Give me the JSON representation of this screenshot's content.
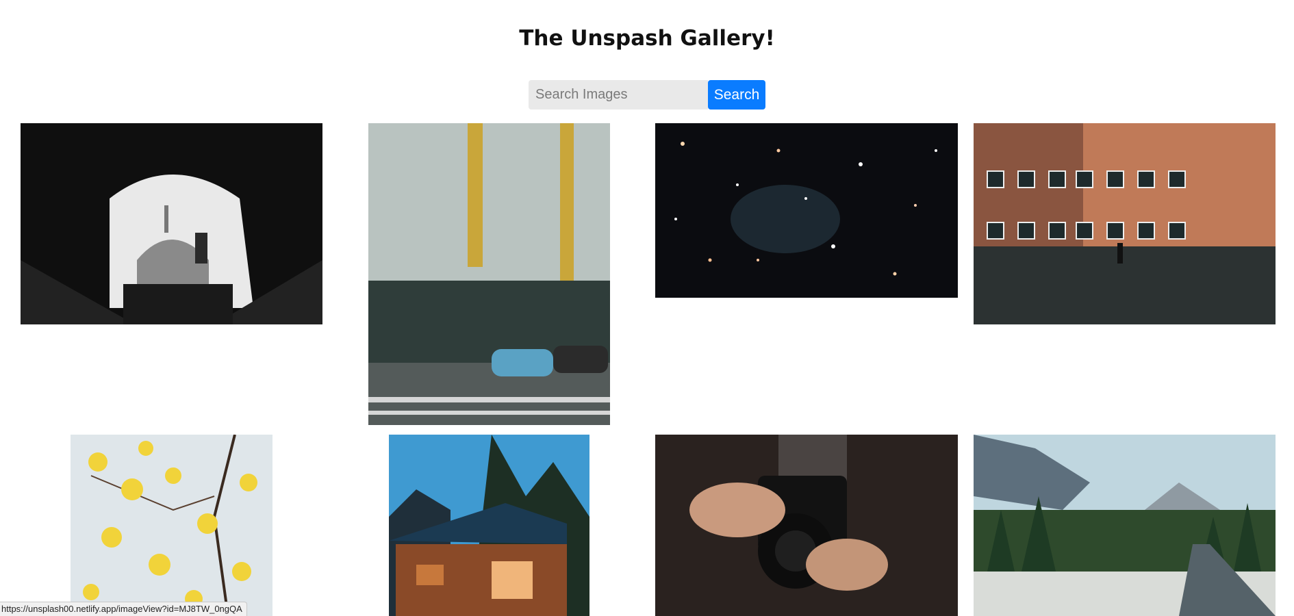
{
  "page": {
    "title": "The Unspash Gallery!"
  },
  "search": {
    "placeholder": "Search Images",
    "value": "",
    "button_label": "Search"
  },
  "gallery": {
    "images": [
      {
        "subject": "mosque-arch",
        "alt": ""
      },
      {
        "subject": "building-facade",
        "alt": ""
      },
      {
        "subject": "starfield",
        "alt": ""
      },
      {
        "subject": "brick-building-runner",
        "alt": ""
      },
      {
        "subject": "yellow-blossoms",
        "alt": ""
      },
      {
        "subject": "cabin-trees",
        "alt": ""
      },
      {
        "subject": "camera-hands",
        "alt": ""
      },
      {
        "subject": "mountain-road",
        "alt": ""
      }
    ]
  },
  "status_bar": {
    "url": "https://unsplash00.netlify.app/imageView?id=MJ8TW_0ngQA"
  },
  "colors": {
    "accent": "#0a7cff",
    "input_bg": "#e9e9e9"
  }
}
